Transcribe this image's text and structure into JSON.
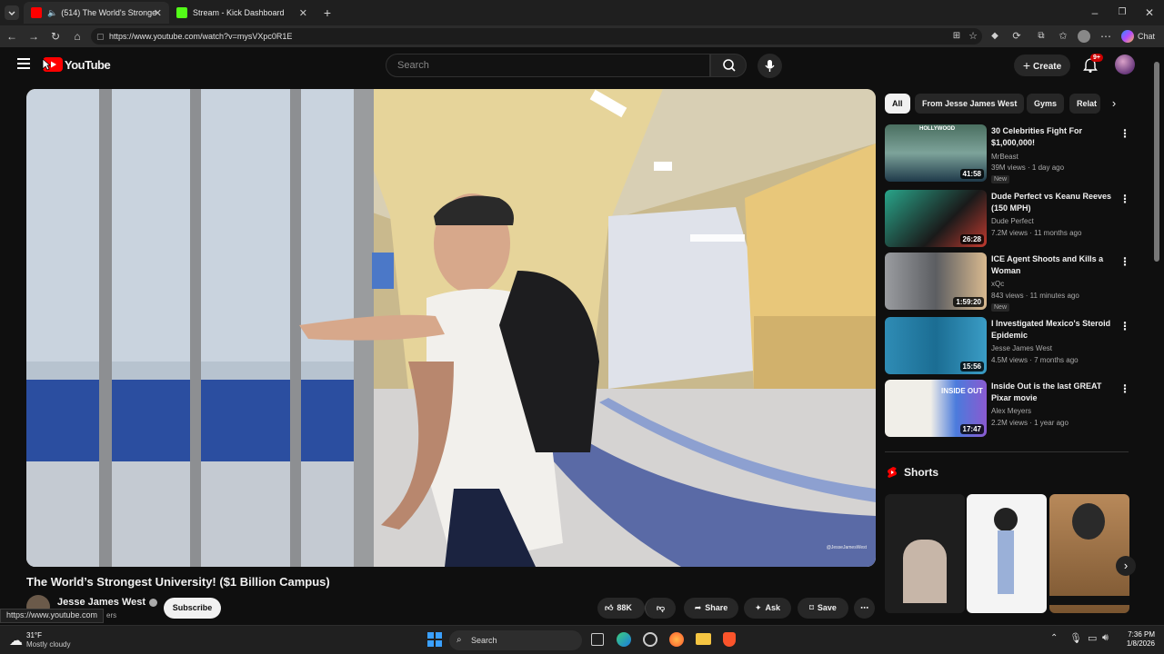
{
  "browser": {
    "tabs": [
      {
        "label": "(514) The World's Strongest U"
      },
      {
        "label": "Stream - Kick Dashboard"
      }
    ],
    "url": "https://www.youtube.com/watch?v=mysVXpc0R1E",
    "chat_label": "Chat"
  },
  "header": {
    "logo_text": "YouTube",
    "search_placeholder": "Search",
    "create_label": "Create",
    "notif_count": "9+"
  },
  "video": {
    "title": "The World’s Strongest University! ($1 Billion Campus)",
    "channel": "Jesse James West",
    "subscribers": "ers",
    "subscribe_label": "Subscribe",
    "likes": "88K",
    "share_label": "Share",
    "ask_label": "Ask",
    "save_label": "Save",
    "watermark": "@JesseJamesWest",
    "status_url": "https://www.youtube.com"
  },
  "chips": [
    "All",
    "From Jesse James West",
    "Gyms",
    "Relat"
  ],
  "recommendations": [
    {
      "title": "30 Celebrities Fight For $1,000,000!",
      "channel": "MrBeast",
      "meta": "39M views · 1 day ago",
      "duration": "41:58",
      "badge": "New",
      "thumb_color": "#5a7d6b",
      "thumb_text": "HOLLYWOOD"
    },
    {
      "title": "Dude Perfect vs Keanu Reeves (150 MPH)",
      "channel": "Dude Perfect",
      "meta": "7.2M views · 11 months ago",
      "duration": "26:28",
      "badge": "",
      "thumb_color": "#3d6a5c",
      "thumb_text": ""
    },
    {
      "title": "ICE Agent Shoots and Kills a Woman",
      "channel": "xQc",
      "meta": "843 views · 11 minutes ago",
      "duration": "1:59:20",
      "badge": "New",
      "thumb_color": "#7b7d82",
      "thumb_text": ""
    },
    {
      "title": "I Investigated Mexico's Steroid Epidemic",
      "channel": "Jesse James West",
      "meta": "4.5M views · 7 months ago",
      "duration": "15:56",
      "badge": "",
      "thumb_color": "#2e7fa3",
      "thumb_text": ""
    },
    {
      "title": "Inside Out is the last GREAT Pixar movie",
      "channel": "Alex Meyers",
      "meta": "2.2M views · 1 year ago",
      "duration": "17:47",
      "badge": "",
      "thumb_color": "#6a5ac8",
      "thumb_text": "INSIDE OUT"
    }
  ],
  "shorts": {
    "heading": "Shorts",
    "items": [
      {
        "color": "#1e1e1e"
      },
      {
        "color": "#f4f4f4"
      },
      {
        "color": "#a07c4a"
      }
    ]
  },
  "taskbar": {
    "weather_temp": "31°F",
    "weather_desc": "Mostly cloudy",
    "search_label": "Search",
    "time": "7:36 PM",
    "date": "1/8/2026"
  }
}
